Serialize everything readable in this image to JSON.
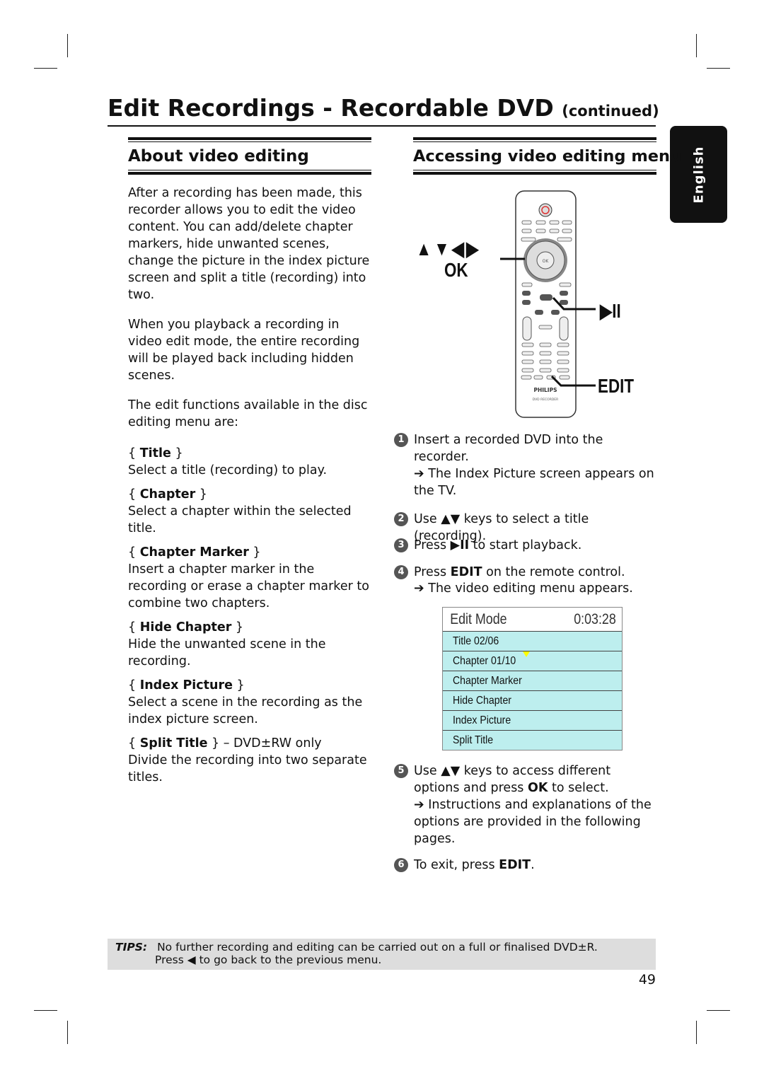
{
  "header": {
    "title": "Edit Recordings - Recordable DVD",
    "suffix": "(continued)"
  },
  "language_tab": "English",
  "left": {
    "heading": "About video editing",
    "paragraphs": [
      "After a recording has been made, this recorder allows you to edit the video content. You can add/delete chapter markers, hide unwanted scenes, change the picture in the index picture screen and split a title (recording) into two.",
      "When you playback a recording in video edit mode, the entire recording will be played back including hidden scenes.",
      "The edit functions available in the disc editing menu are:"
    ],
    "options": [
      {
        "name": "Title",
        "suffix": "",
        "desc": "Select a title (recording) to play."
      },
      {
        "name": "Chapter",
        "suffix": "",
        "desc": "Select a chapter within the selected title."
      },
      {
        "name": "Chapter Marker",
        "suffix": "",
        "desc": "Insert a chapter marker in the recording or erase a chapter marker to combine two chapters."
      },
      {
        "name": "Hide Chapter",
        "suffix": "",
        "desc": "Hide the unwanted scene in the recording."
      },
      {
        "name": "Index Picture",
        "suffix": "",
        "desc": "Select a scene in the recording as the index picture screen."
      },
      {
        "name": "Split Title",
        "suffix": " – DVD±RW only",
        "desc": "Divide the recording into two separate titles."
      }
    ]
  },
  "right": {
    "heading": "Accessing video editing menu",
    "remote": {
      "callout_arrows": "▲▼◀▶",
      "callout_ok": "OK",
      "callout_play": "▶II",
      "callout_edit": "EDIT",
      "brand": "PHILIPS",
      "model": "DVD RECORDER",
      "ok_label": "OK"
    },
    "steps": [
      {
        "n": "1",
        "text": "Insert a recorded DVD into the recorder.",
        "result": "The Index Picture screen appears on the TV."
      },
      {
        "n": "2",
        "pre": "Use ",
        "key": "▲▼",
        "post": " keys to select a title (recording)."
      },
      {
        "n": "3",
        "pre": "Press ",
        "key": "▶II",
        "post": " to start playback."
      },
      {
        "n": "4",
        "pre": "Press ",
        "key": "EDIT",
        "post": " on the remote control.",
        "result": "The video editing menu appears."
      },
      {
        "n": "5",
        "pre": "Use ",
        "key": "▲▼",
        "post": " keys to access different options and press ",
        "key2": "OK",
        "post2": " to select.",
        "result": "Instructions and explanations of the options are provided in the following pages."
      },
      {
        "n": "6",
        "pre": "To exit, press ",
        "key": "EDIT",
        "post": "."
      }
    ],
    "edit_mode": {
      "title": "Edit Mode",
      "time": "0:03:28",
      "rows": [
        "Title 02/06",
        "Chapter 01/10",
        "Chapter Marker",
        "Hide Chapter",
        "Index Picture",
        "Split Title"
      ],
      "row_bg": "#bdeeee",
      "marker_color": "#ffff00"
    }
  },
  "tips": {
    "label": "TIPS:",
    "line1": "No further recording and editing can be carried out on a full or finalised DVD±R.",
    "line2_pre": "Press ",
    "line2_key": "◀",
    "line2_post": " to go back to the previous menu."
  },
  "page_number": "49",
  "arrow_glyph": "➔"
}
